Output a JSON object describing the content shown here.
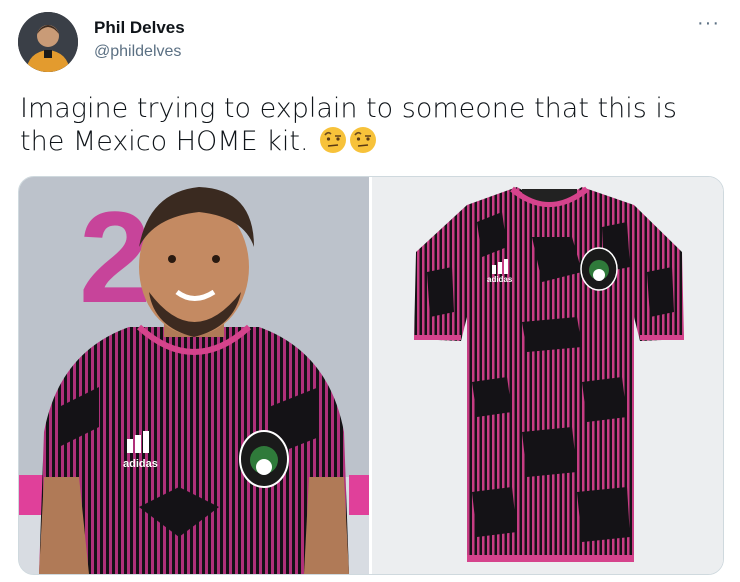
{
  "tweet": {
    "author_name": "Phil Delves",
    "author_handle": "@phildelves",
    "text": "Imagine trying to explain to someone that this is the Mexico HOME kit.",
    "emoji": [
      "face-with-raised-eyebrow",
      "face-with-raised-eyebrow"
    ]
  },
  "media": {
    "left_photo": {
      "number": "2",
      "logo": "adidas"
    },
    "right_photo": {
      "logo": "adidas"
    }
  },
  "colors": {
    "text": "#0f1419",
    "secondary": "#5b7083",
    "kit_pink": "#c73d84",
    "kit_black": "#141216",
    "border": "#cfd9de"
  }
}
